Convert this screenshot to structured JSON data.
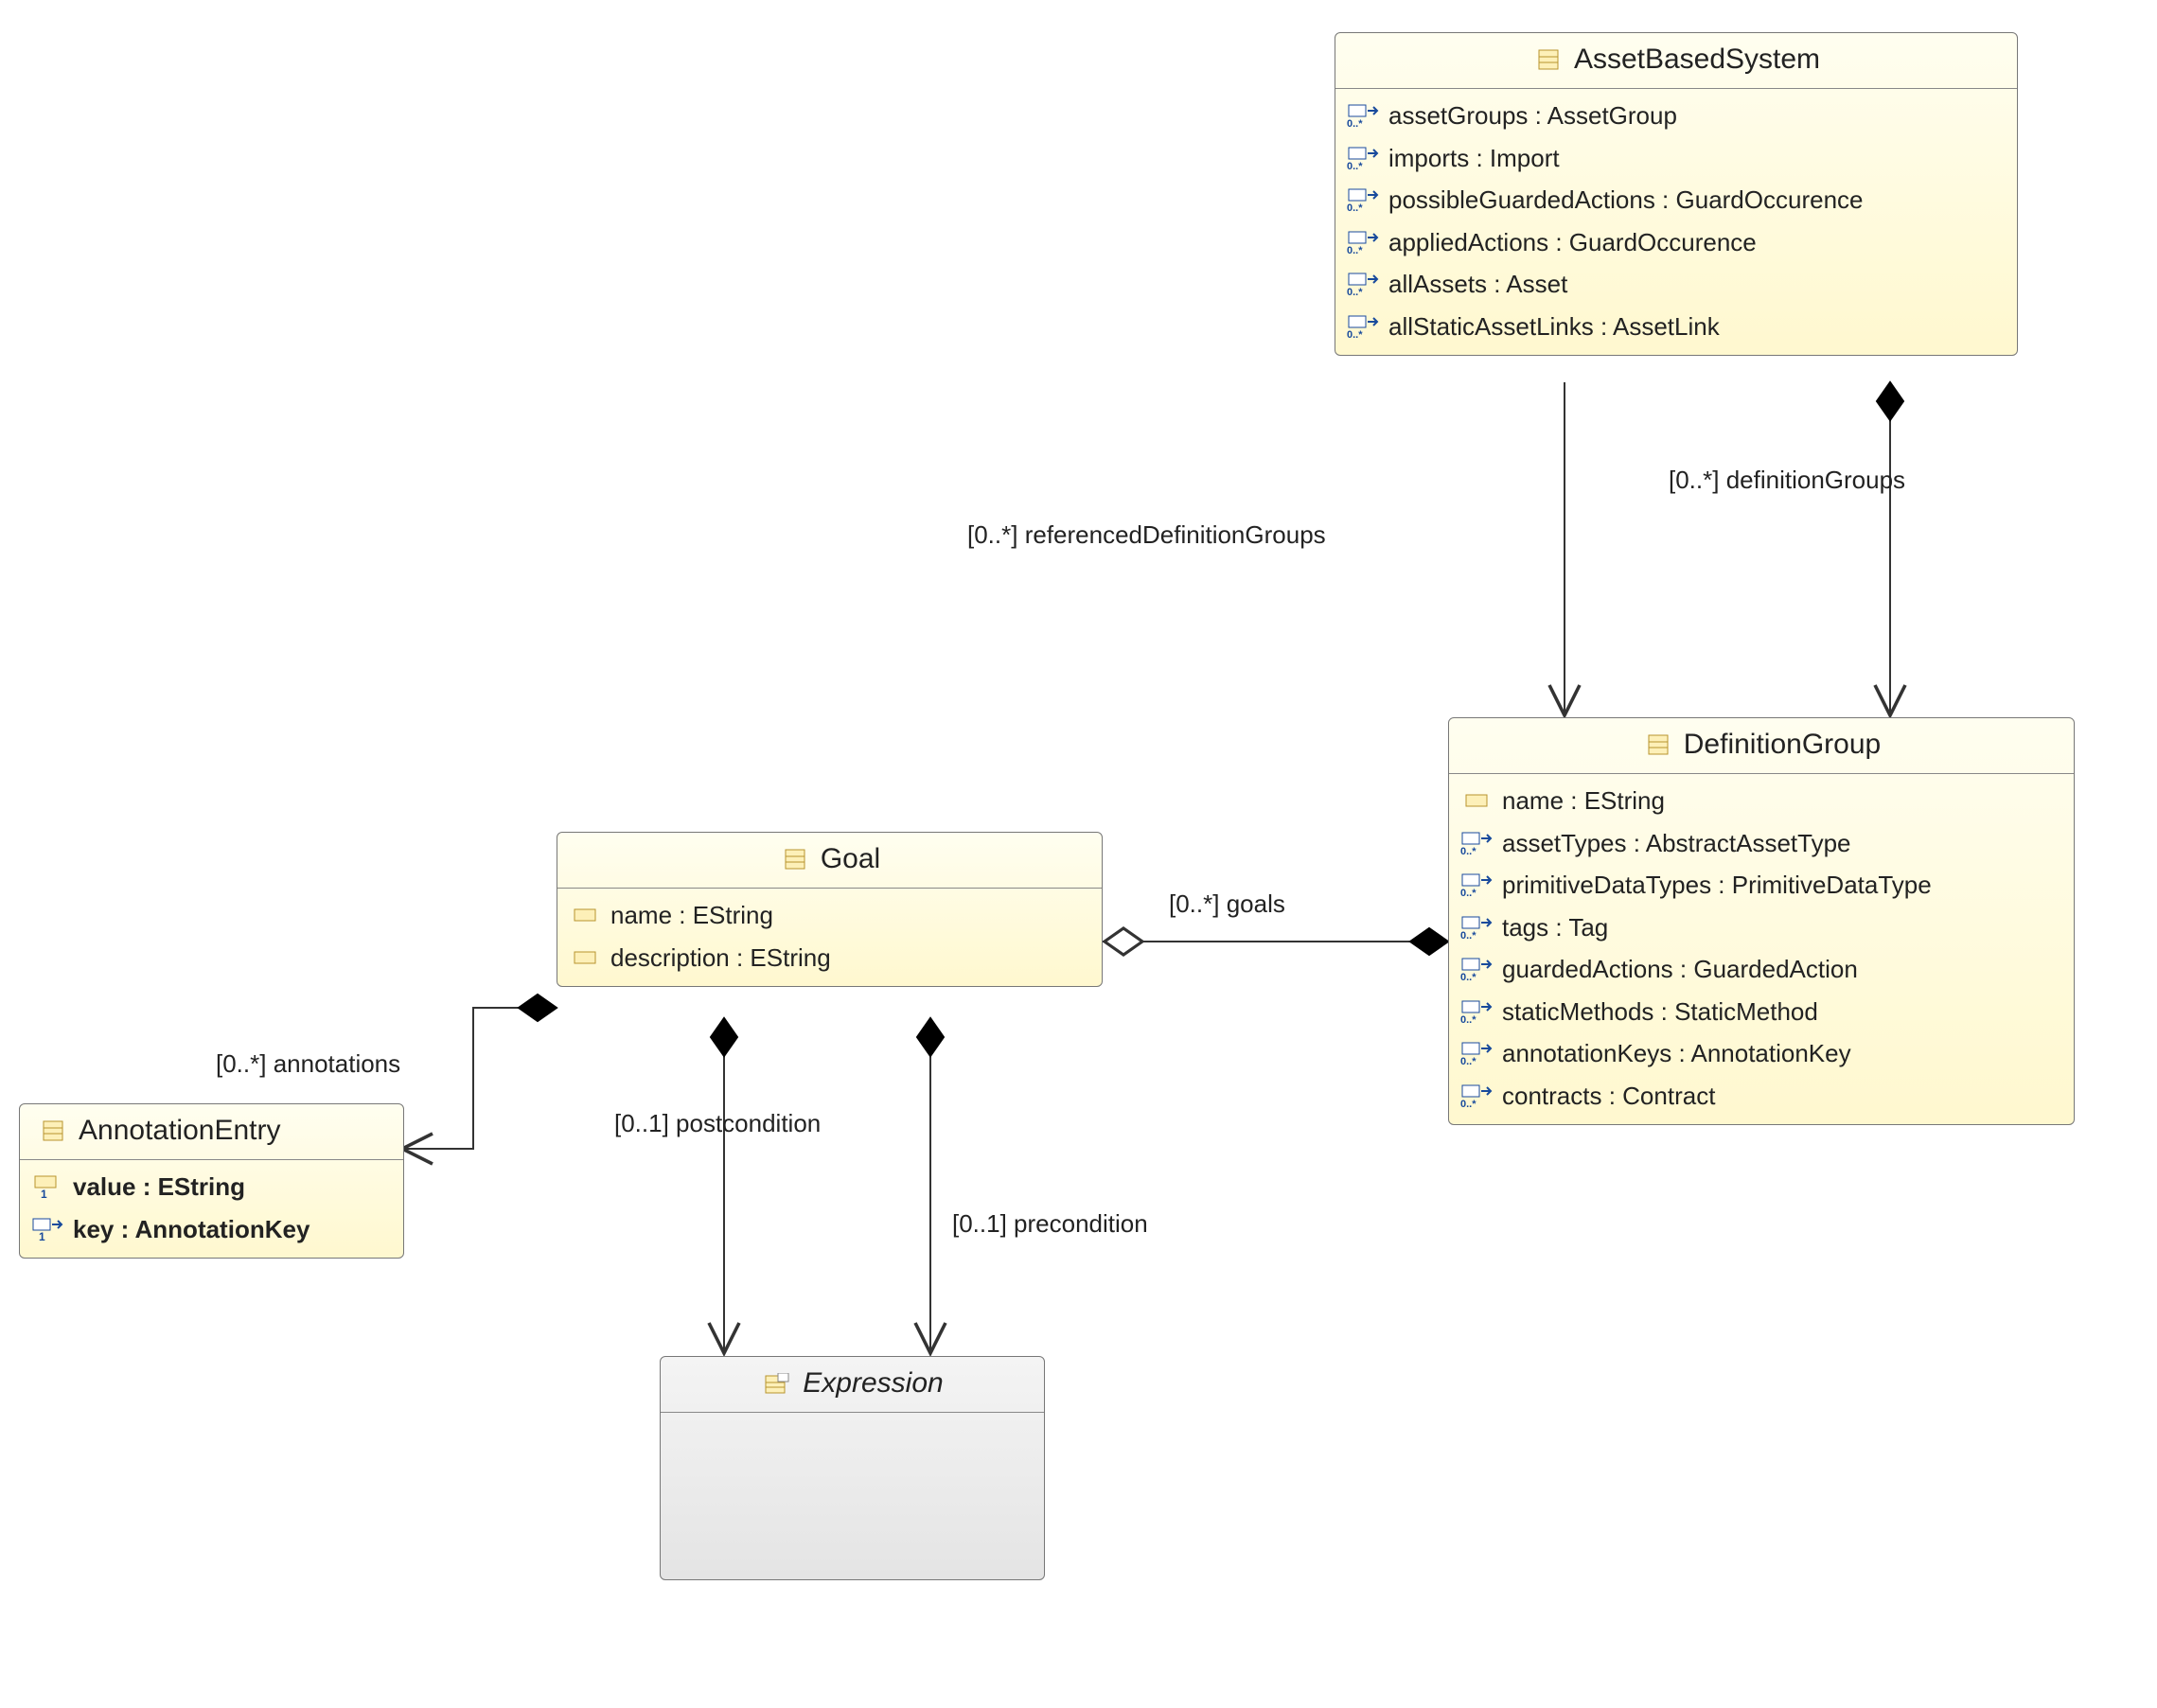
{
  "classes": {
    "assetBasedSystem": {
      "name": "AssetBasedSystem",
      "attrs": [
        {
          "icon": "ref-many",
          "text": "assetGroups : AssetGroup"
        },
        {
          "icon": "ref-many",
          "text": "imports : Import"
        },
        {
          "icon": "ref-many",
          "text": "possibleGuardedActions : GuardOccurence"
        },
        {
          "icon": "ref-many",
          "text": "appliedActions : GuardOccurence"
        },
        {
          "icon": "ref-many",
          "text": "allAssets : Asset"
        },
        {
          "icon": "ref-many",
          "text": "allStaticAssetLinks : AssetLink"
        }
      ]
    },
    "definitionGroup": {
      "name": "DefinitionGroup",
      "attrs": [
        {
          "icon": "attr",
          "text": "name : EString"
        },
        {
          "icon": "ref-many",
          "text": "assetTypes : AbstractAssetType"
        },
        {
          "icon": "ref-many",
          "text": "primitiveDataTypes : PrimitiveDataType"
        },
        {
          "icon": "ref-many",
          "text": "tags : Tag"
        },
        {
          "icon": "ref-many",
          "text": "guardedActions : GuardedAction"
        },
        {
          "icon": "ref-many",
          "text": "staticMethods : StaticMethod"
        },
        {
          "icon": "ref-many",
          "text": "annotationKeys : AnnotationKey"
        },
        {
          "icon": "ref-many",
          "text": "contracts : Contract"
        }
      ]
    },
    "goal": {
      "name": "Goal",
      "attrs": [
        {
          "icon": "attr",
          "text": "name : EString"
        },
        {
          "icon": "attr",
          "text": "description : EString"
        }
      ]
    },
    "annotationEntry": {
      "name": "AnnotationEntry",
      "attrs": [
        {
          "icon": "attr-one",
          "text": "value : EString",
          "bold": true
        },
        {
          "icon": "ref-one",
          "text": "key : AnnotationKey",
          "bold": true
        }
      ]
    },
    "expression": {
      "name": "Expression"
    }
  },
  "edges": {
    "referencedDefinitionGroups": "[0..*] referencedDefinitionGroups",
    "definitionGroups": "[0..*] definitionGroups",
    "goals": "[0..*] goals",
    "annotations": "[0..*] annotations",
    "postcondition": "[0..1] postcondition",
    "precondition": "[0..1] precondition"
  }
}
